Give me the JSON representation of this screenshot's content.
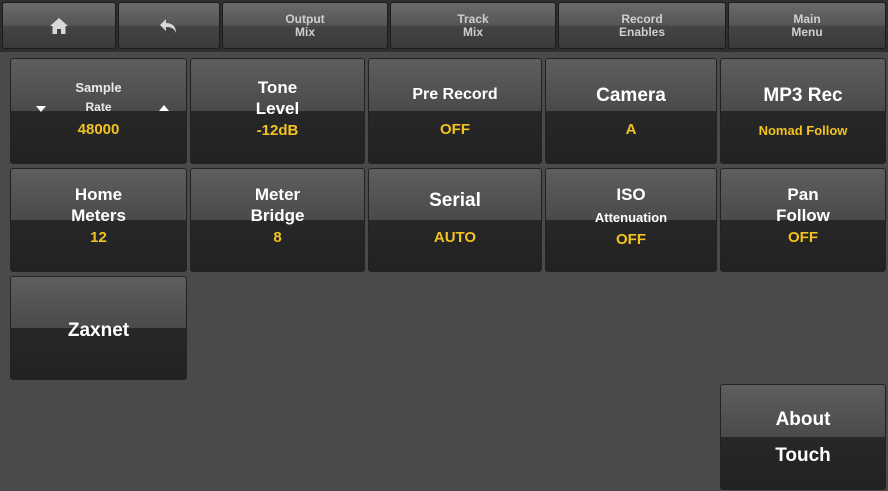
{
  "topbar": {
    "home_icon": "home-icon",
    "back_icon": "back-arrow-icon",
    "output_mix": [
      "Output",
      "Mix"
    ],
    "track_mix": [
      "Track",
      "Mix"
    ],
    "record_enables": [
      "Record",
      "Enables"
    ],
    "main_menu": [
      "Main",
      "Menu"
    ]
  },
  "tiles": {
    "sample_rate": {
      "label1": "Sample",
      "label2": "Rate",
      "value": "48000"
    },
    "tone_level": {
      "label1": "Tone",
      "label2": "Level",
      "value": "-12dB"
    },
    "pre_record": {
      "label": "Pre Record",
      "value": "OFF"
    },
    "camera": {
      "label": "Camera",
      "value": "A"
    },
    "mp3_rec": {
      "label": "MP3 Rec",
      "value": "Nomad Follow"
    },
    "home_meters": {
      "label1": "Home",
      "label2": "Meters",
      "value": "12"
    },
    "meter_bridge": {
      "label1": "Meter",
      "label2": "Bridge",
      "value": "8"
    },
    "serial": {
      "label": "Serial",
      "value": "AUTO"
    },
    "iso": {
      "label1": "ISO",
      "label2": "Attenuation",
      "value": "OFF"
    },
    "pan_follow": {
      "label1": "Pan",
      "label2": "Follow",
      "value": "OFF"
    },
    "zaxnet": {
      "label": "Zaxnet"
    },
    "about_touch": {
      "label1": "About",
      "label2": "Touch"
    }
  },
  "colors": {
    "value_yellow": "#f2c320",
    "background": "#4a4a4a"
  }
}
